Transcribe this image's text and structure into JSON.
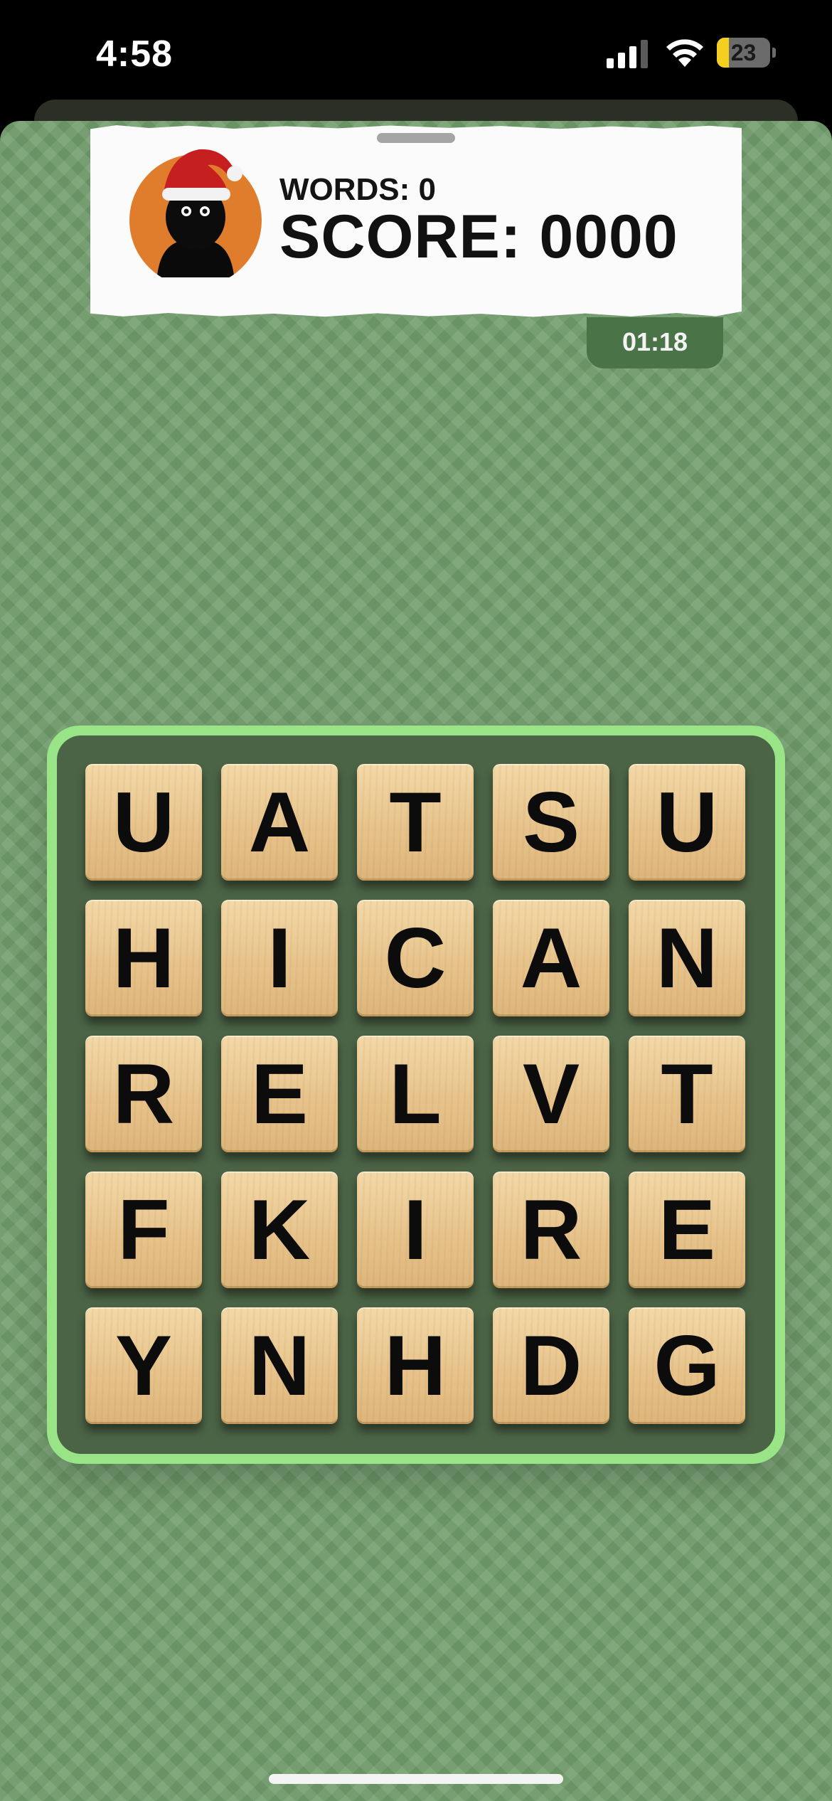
{
  "status_bar": {
    "time": "4:58",
    "battery_level": "23",
    "battery_fraction": 0.23
  },
  "header": {
    "words_label": "WORDS: 0",
    "score_label": "SCORE: 0000",
    "avatar_icon": "santa-hat-character-icon"
  },
  "timer": {
    "value": "01:18"
  },
  "board": {
    "rows": [
      [
        "U",
        "A",
        "T",
        "S",
        "U"
      ],
      [
        "H",
        "I",
        "C",
        "A",
        "N"
      ],
      [
        "R",
        "E",
        "L",
        "V",
        "T"
      ],
      [
        "F",
        "K",
        "I",
        "R",
        "E"
      ],
      [
        "Y",
        "N",
        "H",
        "D",
        "G"
      ]
    ]
  },
  "colors": {
    "background": "#6f9b6a",
    "board_frame": "#98e486",
    "board_inner": "#4c6446",
    "timer_bg": "#4a7448",
    "avatar_bg": "#e07d2c"
  }
}
